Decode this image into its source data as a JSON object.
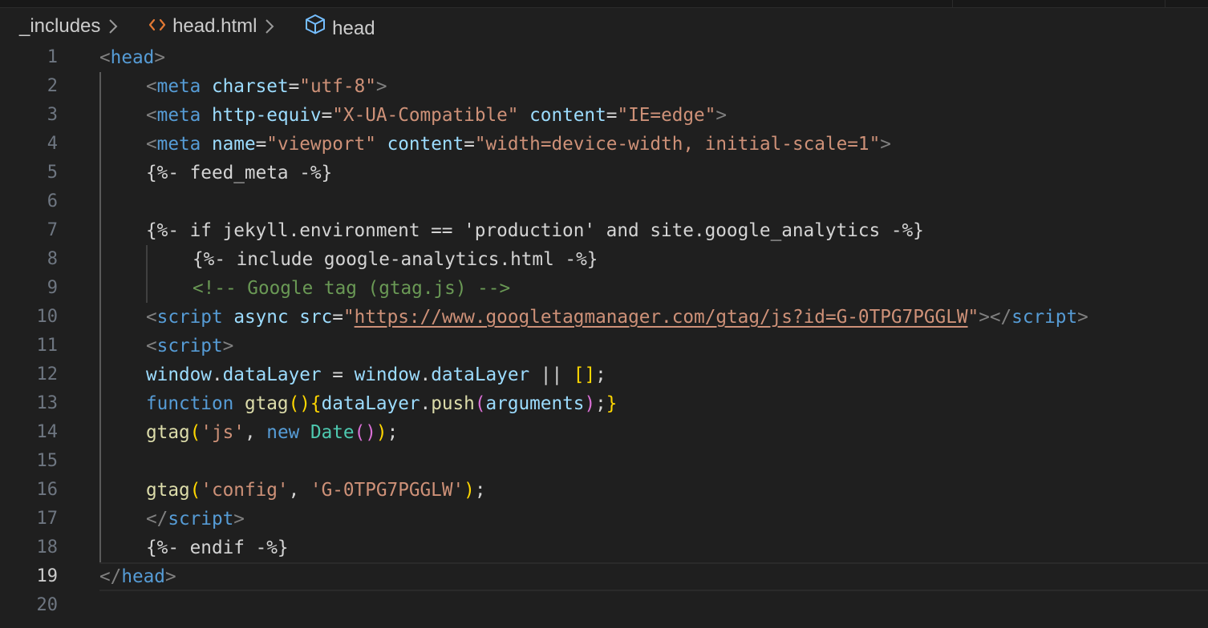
{
  "breadcrumb": {
    "folder": "_includes",
    "file": "head.html",
    "symbol": "head",
    "file_icon": "html-code-icon",
    "symbol_icon": "cube-symbol-icon",
    "separator_icon": "chevron-right-icon"
  },
  "editor": {
    "current_line": 19,
    "line_numbers": [
      "1",
      "2",
      "3",
      "4",
      "5",
      "6",
      "7",
      "8",
      "9",
      "10",
      "11",
      "12",
      "13",
      "14",
      "15",
      "16",
      "17",
      "18",
      "19",
      "20"
    ],
    "lines": [
      {
        "indent": 0,
        "tokens": [
          [
            "t-tag",
            "<"
          ],
          [
            "t-name",
            "head"
          ],
          [
            "t-tag",
            ">"
          ]
        ]
      },
      {
        "indent": 1,
        "tokens": [
          [
            "t-tag",
            "<"
          ],
          [
            "t-name",
            "meta"
          ],
          [
            "t-plain",
            " "
          ],
          [
            "t-attr",
            "charset"
          ],
          [
            "t-plain",
            "="
          ],
          [
            "t-str",
            "\"utf-8\""
          ],
          [
            "t-tag",
            ">"
          ]
        ]
      },
      {
        "indent": 1,
        "tokens": [
          [
            "t-tag",
            "<"
          ],
          [
            "t-name",
            "meta"
          ],
          [
            "t-plain",
            " "
          ],
          [
            "t-attr",
            "http-equiv"
          ],
          [
            "t-plain",
            "="
          ],
          [
            "t-str",
            "\"X-UA-Compatible\""
          ],
          [
            "t-plain",
            " "
          ],
          [
            "t-attr",
            "content"
          ],
          [
            "t-plain",
            "="
          ],
          [
            "t-str",
            "\"IE=edge\""
          ],
          [
            "t-tag",
            ">"
          ]
        ]
      },
      {
        "indent": 1,
        "tokens": [
          [
            "t-tag",
            "<"
          ],
          [
            "t-name",
            "meta"
          ],
          [
            "t-plain",
            " "
          ],
          [
            "t-attr",
            "name"
          ],
          [
            "t-plain",
            "="
          ],
          [
            "t-str",
            "\"viewport\""
          ],
          [
            "t-plain",
            " "
          ],
          [
            "t-attr",
            "content"
          ],
          [
            "t-plain",
            "="
          ],
          [
            "t-str",
            "\"width=device-width, initial-scale=1\""
          ],
          [
            "t-tag",
            ">"
          ]
        ]
      },
      {
        "indent": 1,
        "tokens": [
          [
            "t-plain",
            "{%- feed_meta -%}"
          ]
        ]
      },
      {
        "indent": 1,
        "tokens": []
      },
      {
        "indent": 1,
        "tokens": [
          [
            "t-plain",
            "{%- if jekyll.environment == 'production' and site.google_analytics -%}"
          ]
        ]
      },
      {
        "indent": 2,
        "tokens": [
          [
            "t-plain",
            "{%- include google-analytics.html -%}"
          ]
        ]
      },
      {
        "indent": 2,
        "tokens": [
          [
            "t-com",
            "<!-- Google tag (gtag.js) -->"
          ]
        ]
      },
      {
        "indent": 1,
        "tokens": [
          [
            "t-tag",
            "<"
          ],
          [
            "t-name",
            "script"
          ],
          [
            "t-plain",
            " "
          ],
          [
            "t-attr",
            "async"
          ],
          [
            "t-plain",
            " "
          ],
          [
            "t-attr",
            "src"
          ],
          [
            "t-plain",
            "="
          ],
          [
            "t-str",
            "\""
          ],
          [
            "t-link",
            "https://www.googletagmanager.com/gtag/js?id=G-0TPG7PGGLW"
          ],
          [
            "t-str",
            "\""
          ],
          [
            "t-tag",
            "></"
          ],
          [
            "t-name",
            "script"
          ],
          [
            "t-tag",
            ">"
          ]
        ]
      },
      {
        "indent": 1,
        "tokens": [
          [
            "t-tag",
            "<"
          ],
          [
            "t-name",
            "script"
          ],
          [
            "t-tag",
            ">"
          ]
        ]
      },
      {
        "indent": 1,
        "tokens": [
          [
            "t-var",
            "window"
          ],
          [
            "t-plain",
            "."
          ],
          [
            "t-var",
            "dataLayer"
          ],
          [
            "t-plain",
            " = "
          ],
          [
            "t-var",
            "window"
          ],
          [
            "t-plain",
            "."
          ],
          [
            "t-var",
            "dataLayer"
          ],
          [
            "t-plain",
            " || "
          ],
          [
            "t-b1",
            "[]"
          ],
          [
            "t-plain",
            ";"
          ]
        ]
      },
      {
        "indent": 1,
        "tokens": [
          [
            "t-kw",
            "function"
          ],
          [
            "t-plain",
            " "
          ],
          [
            "t-fn",
            "gtag"
          ],
          [
            "t-b1",
            "()"
          ],
          [
            "t-b1",
            "{"
          ],
          [
            "t-var",
            "dataLayer"
          ],
          [
            "t-plain",
            "."
          ],
          [
            "t-fn",
            "push"
          ],
          [
            "t-b2",
            "("
          ],
          [
            "t-var",
            "arguments"
          ],
          [
            "t-b2",
            ")"
          ],
          [
            "t-plain",
            ";"
          ],
          [
            "t-b1",
            "}"
          ]
        ]
      },
      {
        "indent": 1,
        "tokens": [
          [
            "t-fn",
            "gtag"
          ],
          [
            "t-b1",
            "("
          ],
          [
            "t-str",
            "'js'"
          ],
          [
            "t-plain",
            ", "
          ],
          [
            "t-kw",
            "new"
          ],
          [
            "t-plain",
            " "
          ],
          [
            "t-cls",
            "Date"
          ],
          [
            "t-b2",
            "()"
          ],
          [
            "t-b1",
            ")"
          ],
          [
            "t-plain",
            ";"
          ]
        ]
      },
      {
        "indent": 1,
        "tokens": []
      },
      {
        "indent": 1,
        "tokens": [
          [
            "t-fn",
            "gtag"
          ],
          [
            "t-b1",
            "("
          ],
          [
            "t-str",
            "'config'"
          ],
          [
            "t-plain",
            ", "
          ],
          [
            "t-str",
            "'G-0TPG7PGGLW'"
          ],
          [
            "t-b1",
            ")"
          ],
          [
            "t-plain",
            ";"
          ]
        ]
      },
      {
        "indent": 1,
        "tokens": [
          [
            "t-tag",
            "</"
          ],
          [
            "t-name",
            "script"
          ],
          [
            "t-tag",
            ">"
          ]
        ]
      },
      {
        "indent": 1,
        "tokens": [
          [
            "t-plain",
            "{%- endif -%}"
          ]
        ]
      },
      {
        "indent": 0,
        "tokens": [
          [
            "t-tag",
            "</"
          ],
          [
            "t-name",
            "head"
          ],
          [
            "t-tag",
            ">"
          ]
        ]
      },
      {
        "indent": 0,
        "tokens": []
      }
    ]
  }
}
